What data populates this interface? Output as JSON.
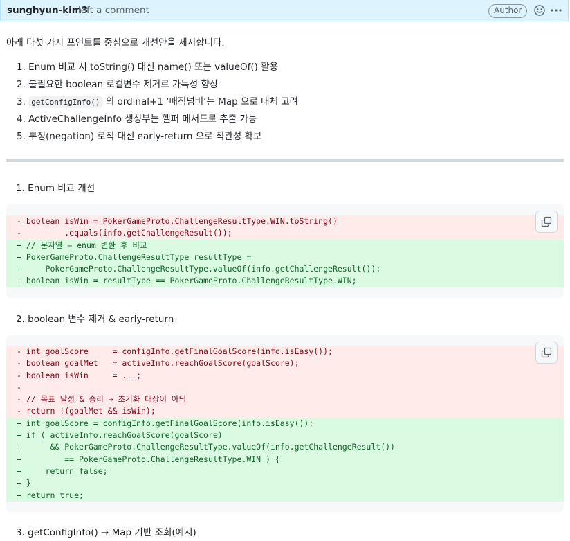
{
  "comment": {
    "author": "sunghyun-kim3",
    "action": "left a comment",
    "badge": "Author"
  },
  "intro": "아래 다섯 가지 포인트를 중심으로 개선안을 제시합니다.",
  "points": [
    "1. Enum 비교 시 toString() 대신 name() 또는 valueOf() 활용",
    "2. 불필요한 boolean 로컬변수 제거로 가독성 향상",
    {
      "prefix": "3.",
      "code": "getConfigInfo()",
      "suffix": "의 ordinal+1 ‘매직넘버’는 Map 으로 대체 고려"
    },
    "4. ActiveChallengeInfo 생성부는 헬퍼 메서드로 추출 가능",
    "5. 부정(negation) 로직 대신 early-return 으로 직관성 확보"
  ],
  "sections": [
    {
      "title": "1. Enum 비교 개선",
      "lines": [
        {
          "type": "del",
          "text": "- boolean isWin = PokerGameProto.ChallengeResultType.WIN.toString()"
        },
        {
          "type": "del",
          "text": "-         .equals(info.getChallengeResult());"
        },
        {
          "type": "add",
          "text": "+ // 문자열 → enum 변환 후 비교"
        },
        {
          "type": "add",
          "text": "+ PokerGameProto.ChallengeResultType resultType ="
        },
        {
          "type": "add",
          "text": "+     PokerGameProto.ChallengeResultType.valueOf(info.getChallengeResult());"
        },
        {
          "type": "add",
          "text": "+ boolean isWin = resultType == PokerGameProto.ChallengeResultType.WIN;"
        }
      ]
    },
    {
      "title": "2. boolean 변수 제거 & early-return",
      "lines": [
        {
          "type": "del",
          "text": "- int goalScore     = configInfo.getFinalGoalScore(info.isEasy());"
        },
        {
          "type": "del",
          "text": "- boolean goalMet   = activeInfo.reachGoalScore(goalScore);"
        },
        {
          "type": "del",
          "text": "- boolean isWin     = ...;"
        },
        {
          "type": "del",
          "text": "-"
        },
        {
          "type": "del",
          "text": "- // 목표 달성 & 승리 → 초기화 대상이 아님"
        },
        {
          "type": "del",
          "text": "- return !(goalMet && isWin);"
        },
        {
          "type": "add",
          "text": "+ int goalScore = configInfo.getFinalGoalScore(info.isEasy());"
        },
        {
          "type": "add",
          "text": "+ if ( activeInfo.reachGoalScore(goalScore)"
        },
        {
          "type": "add",
          "text": "+      && PokerGameProto.ChallengeResultType.valueOf(info.getChallengeResult())"
        },
        {
          "type": "add",
          "text": "+         == PokerGameProto.ChallengeResultType.WIN ) {"
        },
        {
          "type": "add",
          "text": "+     return false;"
        },
        {
          "type": "add",
          "text": "+ }"
        },
        {
          "type": "add",
          "text": "+ return true;"
        }
      ]
    },
    {
      "title": "3. getConfigInfo() → Map 기반 조회(예시)",
      "lines": []
    }
  ],
  "icons": {
    "emoji": "smiley-icon",
    "more": "kebab-horizontal-icon",
    "copy": "copy-icon"
  },
  "colors": {
    "header_bg": "#ddf4ff",
    "del_bg": "#ffebe9",
    "add_bg": "#dafbe1",
    "code_bg": "#f6f8fa"
  }
}
